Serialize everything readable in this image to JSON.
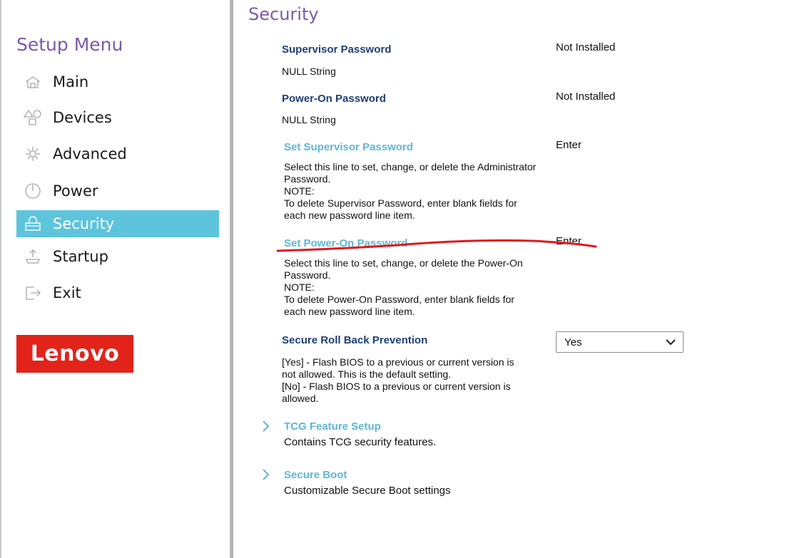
{
  "sidebar": {
    "title": "Setup Menu",
    "items": [
      {
        "label": "Main",
        "icon": "home-icon",
        "active": false
      },
      {
        "label": "Devices",
        "icon": "devices-icon",
        "active": false
      },
      {
        "label": "Advanced",
        "icon": "advanced-icon",
        "active": false
      },
      {
        "label": "Power",
        "icon": "power-icon",
        "active": false
      },
      {
        "label": "Security",
        "icon": "lock-icon",
        "active": true
      },
      {
        "label": "Startup",
        "icon": "startup-icon",
        "active": false
      },
      {
        "label": "Exit",
        "icon": "exit-icon",
        "active": false
      }
    ],
    "logo_text": "Lenovo"
  },
  "colors": {
    "accent_purple": "#7b5aa6",
    "active_bg": "#5ec4dc",
    "link_blue": "#5fb6d3",
    "label_navy": "#1d3f73",
    "logo_red": "#e2231a",
    "annotation_red": "#e0181e"
  },
  "main": {
    "title": "Security",
    "supervisor_password": {
      "label": "Supervisor Password",
      "value": "Not Installed",
      "sub": "NULL String"
    },
    "poweron_password": {
      "label": "Power-On Password",
      "value": "Not Installed",
      "sub": "NULL String"
    },
    "set_supervisor": {
      "label": "Set Supervisor Password",
      "value": "Enter",
      "desc": [
        "Select this line to set, change, or delete the Administrator",
        "Password.",
        "NOTE:",
        "To delete Supervisor Password, enter blank fields for",
        "each new password line item."
      ]
    },
    "set_poweron": {
      "label": "Set Power-On Password",
      "value": "Enter",
      "desc": [
        "Select this line to set, change, or delete the Power-On",
        "Password.",
        "NOTE:",
        "To delete Power-On Password, enter blank fields for",
        "each new password line item."
      ]
    },
    "rollback": {
      "label": "Secure Roll Back Prevention",
      "selected": "Yes",
      "desc": [
        "[Yes] - Flash BIOS to a previous or current version is",
        "not allowed. This is the default setting.",
        "[No] - Flash BIOS to a previous or current version is",
        "allowed."
      ]
    },
    "tcg": {
      "label": "TCG Feature Setup",
      "desc": "Contains TCG security features."
    },
    "secure_boot": {
      "label": "Secure Boot",
      "desc": "Customizable Secure Boot settings"
    }
  }
}
